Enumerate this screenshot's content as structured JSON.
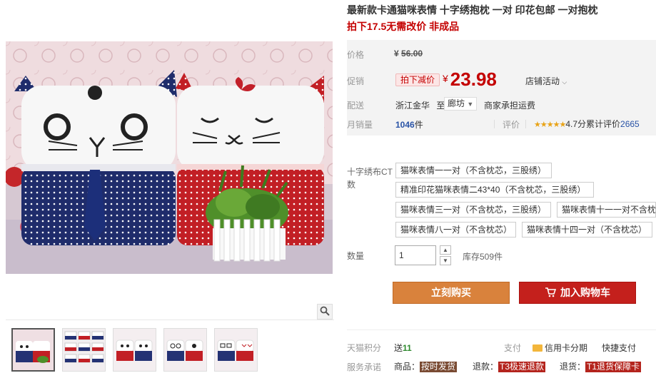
{
  "product": {
    "title": "最新款卡通猫咪表情 十字绣抱枕 一对 印花包邮 一对抱枕",
    "subtitle": "拍下17.5无需改价 非成品"
  },
  "price": {
    "label": "价格",
    "currency": "¥",
    "original": "56.00"
  },
  "promo": {
    "label": "促销",
    "badge": "拍下减价",
    "currency": "¥",
    "price": "23.98",
    "store_activity": "店铺活动"
  },
  "shipping": {
    "label": "配送",
    "from": "浙江金华",
    "to_word": "至",
    "to_city": "廊坊",
    "note": "商家承担运费"
  },
  "sales": {
    "label": "月销量",
    "count": "1046",
    "unit": "件",
    "review_label": "评价",
    "stars": "★★★★★",
    "score": "4.7分",
    "review_text": "累计评价",
    "review_count": "2665"
  },
  "sku": {
    "label": "十字绣布CT数",
    "options": [
      "猫咪表情一一对（不含枕芯，三股绣）",
      "精准印花猫咪表情二43*40（不含枕芯，三股绣）",
      "猫咪表情三一对（不含枕芯，三股绣）",
      "猫咪表情十一一对不含枕芯",
      "猫咪表情八一对（不含枕芯）",
      "猫咪表情十四一对（不含枕芯）"
    ]
  },
  "quantity": {
    "label": "数量",
    "value": "1",
    "stock": "库存509件"
  },
  "actions": {
    "buy_now": "立刻购买",
    "add_to_cart": "加入购物车"
  },
  "points": {
    "label": "天猫积分",
    "prefix": "送",
    "value": "11"
  },
  "payment": {
    "label": "支付",
    "items": [
      "信用卡分期",
      "快捷支付"
    ]
  },
  "service": {
    "label": "服务承诺",
    "items": [
      {
        "prefix": "商品：",
        "tag": "按时发货"
      },
      {
        "prefix": "退款：",
        "tag": "T3极速退款"
      },
      {
        "prefix": "退货：",
        "tag": "T1退货保障卡"
      }
    ]
  },
  "icons": {
    "zoom": "magnifier-icon",
    "cart": "cart-icon",
    "dropdown": "chevron-down-icon",
    "credit": "credit-card-icon"
  },
  "colors": {
    "price_red": "#c40000",
    "buy_orange": "#d9823c",
    "cart_red": "#c4201c",
    "link_blue": "#2953a6"
  }
}
